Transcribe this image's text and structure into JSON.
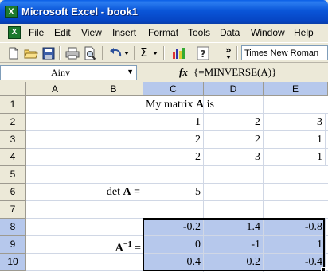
{
  "window": {
    "title": "Microsoft Excel - book1"
  },
  "menu": {
    "items": [
      {
        "label": "File",
        "hot": "F",
        "rest": "ile"
      },
      {
        "label": "Edit",
        "hot": "E",
        "rest": "dit"
      },
      {
        "label": "View",
        "hot": "V",
        "rest": "iew"
      },
      {
        "label": "Insert",
        "hot": "I",
        "rest": "nsert"
      },
      {
        "label": "Format",
        "hot": "o",
        "pre": "F",
        "rest": "rmat"
      },
      {
        "label": "Tools",
        "hot": "T",
        "rest": "ools"
      },
      {
        "label": "Data",
        "hot": "D",
        "rest": "ata"
      },
      {
        "label": "Window",
        "hot": "W",
        "rest": "indow"
      },
      {
        "label": "Help",
        "hot": "H",
        "rest": "elp"
      }
    ]
  },
  "toolbar": {
    "sigma": "Σ",
    "font_name": "Times New Roman",
    "more": "»"
  },
  "formula_bar": {
    "name_box": "Ainv",
    "fx": "fx",
    "formula": "{=MINVERSE(A)}"
  },
  "sheet": {
    "columns": [
      "A",
      "B",
      "C",
      "D",
      "E"
    ],
    "rows": [
      "1",
      "2",
      "3",
      "4",
      "5",
      "6",
      "7",
      "8",
      "9",
      "10"
    ],
    "c1_text_pre": "My matrix ",
    "c1_text_bold": "A",
    "c1_text_post": " is",
    "matrix_a": [
      [
        "1",
        "2",
        "3"
      ],
      [
        "2",
        "2",
        "1"
      ],
      [
        "2",
        "3",
        "1"
      ]
    ],
    "det_label_pre": "det ",
    "det_label_bold": "A",
    "det_label_post": " =",
    "det_value": "5",
    "inv_label_bold": "A",
    "inv_label_sup": "−1",
    "inv_label_post": " =",
    "matrix_inv": [
      [
        "-0.2",
        "1.4",
        "-0.8"
      ],
      [
        "0",
        "-1",
        "1"
      ],
      [
        "0.4",
        "0.2",
        "-0.4"
      ]
    ]
  }
}
